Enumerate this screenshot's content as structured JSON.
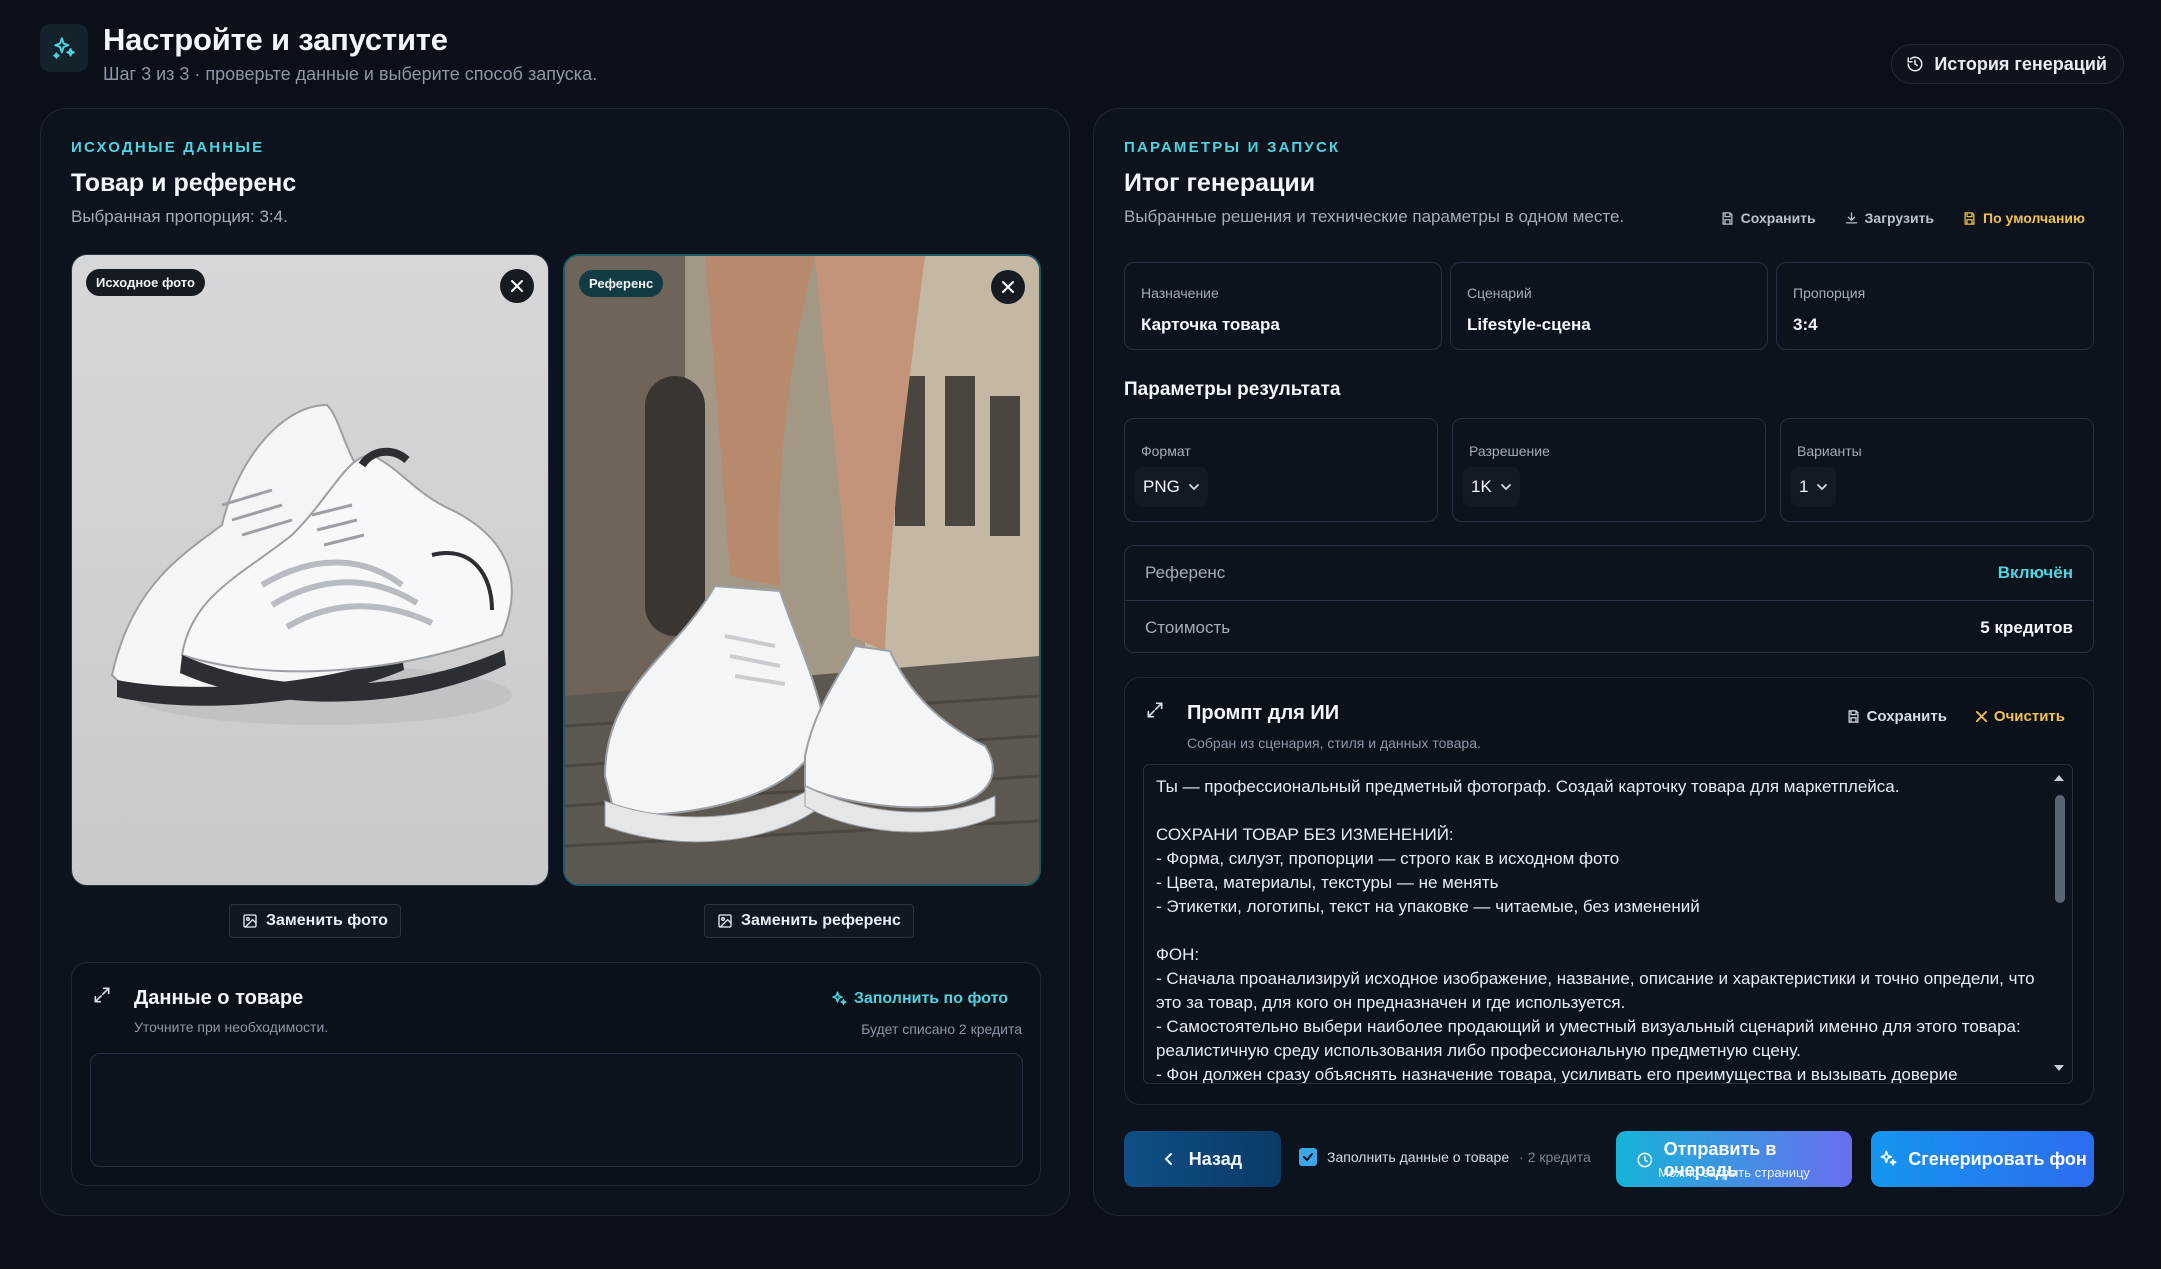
{
  "header": {
    "title": "Настройте и запустите",
    "subtitle": "Шаг 3 из 3 · проверьте данные и выберите способ запуска.",
    "history_label": "История генераций"
  },
  "left": {
    "eyebrow": "ИСХОДНЫЕ ДАННЫЕ",
    "title": "Товар и референс",
    "subtitle": "Выбранная пропорция: 3:4.",
    "source_tag": "Исходное фото",
    "reference_tag": "Референс",
    "replace_photo": "Заменить фото",
    "replace_reference": "Заменить референс",
    "product": {
      "title": "Данные о товаре",
      "subtitle": "Уточните при необходимости.",
      "fill_label": "Заполнить по фото",
      "fill_cost": "Будет списано 2 кредита",
      "value": ""
    }
  },
  "right": {
    "eyebrow": "ПАРАМЕТРЫ И ЗАПУСК",
    "title": "Итог генерации",
    "subtitle": "Выбранные решения и технические параметры в одном месте.",
    "actions": {
      "save": "Сохранить",
      "load": "Загрузить",
      "default": "По умолчанию"
    },
    "summary": [
      {
        "label": "Назначение",
        "value": "Карточка товара"
      },
      {
        "label": "Сценарий",
        "value": "Lifestyle-сцена"
      },
      {
        "label": "Пропорция",
        "value": "3:4"
      }
    ],
    "result_title": "Параметры результата",
    "params": [
      {
        "label": "Формат",
        "value": "PNG"
      },
      {
        "label": "Разрешение",
        "value": "1K"
      },
      {
        "label": "Варианты",
        "value": "1"
      }
    ],
    "info": [
      {
        "label": "Референс",
        "value": "Включён"
      },
      {
        "label": "Стоимость",
        "value": "5 кредитов"
      }
    ],
    "prompt": {
      "title": "Промпт для ИИ",
      "subtitle": "Собран из сценария, стиля и данных товара.",
      "save": "Сохранить",
      "clear": "Очистить",
      "text": "Ты — профессиональный предметный фотограф. Создай карточку товара для маркетплейса.\n\nСОХРАНИ ТОВАР БЕЗ ИЗМЕНЕНИЙ:\n- Форма, силуэт, пропорции — строго как в исходном фото\n- Цвета, материалы, текстуры — не менять\n- Этикетки, логотипы, текст на упаковке — читаемые, без изменений\n\nФОН:\n- Сначала проанализируй исходное изображение, название, описание и характеристики и точно определи, что это за товар, для кого он предназначен и где используется.\n- Самостоятельно выбери наиболее продающий и уместный визуальный сценарий именно для этого товара: реалистичную среду использования либо профессиональную предметную сцену.\n- Фон должен сразу объяснять назначение товара, усиливать его преимущества и вызывать доверие покупателя."
    },
    "back_label": "Назад",
    "checkbox_label": "Заполнить данные о товаре",
    "checkbox_cost": "· 2 кредита",
    "queue_label": "Отправить в очередь",
    "queue_sub": "Можно закрыть страницу",
    "generate_label": "Сгенерировать фон"
  }
}
